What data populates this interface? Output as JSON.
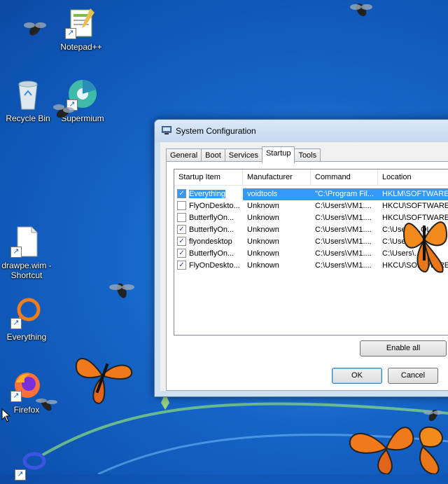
{
  "desktop": {
    "icons": [
      {
        "label": "Notepad++",
        "icon": "notepad-plus-plus-icon"
      },
      {
        "label": "Recycle Bin",
        "icon": "recycle-bin-icon"
      },
      {
        "label": "Supermium",
        "icon": "supermium-icon"
      },
      {
        "label": "drawpe.wim - Shortcut",
        "icon": "file-icon"
      },
      {
        "label": "Everything",
        "icon": "everything-icon"
      },
      {
        "label": "Firefox",
        "icon": "firefox-icon"
      }
    ]
  },
  "window": {
    "title": "System Configuration",
    "tabs": [
      "General",
      "Boot",
      "Services",
      "Startup",
      "Tools"
    ],
    "active_tab": "Startup",
    "columns": [
      "Startup Item",
      "Manufacturer",
      "Command",
      "Location"
    ],
    "rows": [
      {
        "checked": true,
        "item": "Everything",
        "manufacturer": "voidtools",
        "command": "\"C:\\Program Fil...",
        "location": "HKLM\\SOFTWARE\\W"
      },
      {
        "checked": false,
        "item": "FlyOnDeskto...",
        "manufacturer": "Unknown",
        "command": "C:\\Users\\VM1....",
        "location": "HKCU\\SOFTWARE\\"
      },
      {
        "checked": false,
        "item": "ButterflyOn...",
        "manufacturer": "Unknown",
        "command": "C:\\Users\\VM1....",
        "location": "HKCU\\SOFTWARE\\"
      },
      {
        "checked": true,
        "item": "ButterflyOn...",
        "manufacturer": "Unknown",
        "command": "C:\\Users\\VM1....",
        "location": "C:\\Users\\...OLL"
      },
      {
        "checked": true,
        "item": "flyondesktop",
        "manufacturer": "Unknown",
        "command": "C:\\Users\\VM1....",
        "location": "C:\\Users\\...L"
      },
      {
        "checked": true,
        "item": "ButterflyOn...",
        "manufacturer": "Unknown",
        "command": "C:\\Users\\VM1....",
        "location": "C:\\Users\\...OL"
      },
      {
        "checked": true,
        "item": "FlyOnDeskto...",
        "manufacturer": "Unknown",
        "command": "C:\\Users\\VM1....",
        "location": "HKCU\\SOFTWARE\\"
      }
    ],
    "buttons": {
      "enable_all": "Enable all",
      "ok": "OK",
      "cancel": "Cancel"
    }
  },
  "colors": {
    "selection": "#3399ff",
    "desktop": "#1565c8"
  }
}
